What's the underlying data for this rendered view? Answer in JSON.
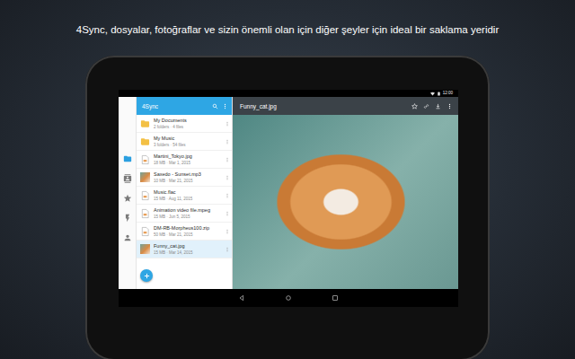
{
  "caption": "4Sync, dosyalar, fotoğraflar ve sizin önemli olan için diğer şeyler için ideal bir saklama yeridir",
  "status_bar": {
    "time": "12:00"
  },
  "nav": [
    {
      "selected": true
    },
    {
      "selected": false
    },
    {
      "selected": false
    },
    {
      "selected": false
    },
    {
      "selected": false
    }
  ],
  "list_header": {
    "title": "4Sync"
  },
  "files": [
    {
      "name": "My Documents",
      "meta": "2 folders · 4 files",
      "kind": "folder",
      "selected": false
    },
    {
      "name": "My Music",
      "meta": "3 folders · 54 files",
      "kind": "folder",
      "selected": false
    },
    {
      "name": "Martini_Tokyo.jpg",
      "meta": "18 MB · Mar 1, 2015",
      "kind": "file",
      "selected": false
    },
    {
      "name": "Saxedo - Sunset.mp3",
      "meta": "10 MB · Mar 21, 2015",
      "kind": "thumb",
      "selected": false
    },
    {
      "name": "Music.flac",
      "meta": "15 MB · Aug 11, 2015",
      "kind": "file",
      "selected": false
    },
    {
      "name": "Animation video file.mpeg",
      "meta": "15 MB · Jun 5, 2015",
      "kind": "file",
      "selected": false
    },
    {
      "name": "DM-RB-Morpheus100.zip",
      "meta": "50 MB · Mar 21, 2015",
      "kind": "file",
      "selected": false
    },
    {
      "name": "Funny_cat.jpg",
      "meta": "15 MB · Mar 14, 2015",
      "kind": "thumb",
      "selected": true
    }
  ],
  "viewer": {
    "title": "Funny_cat.jpg"
  }
}
